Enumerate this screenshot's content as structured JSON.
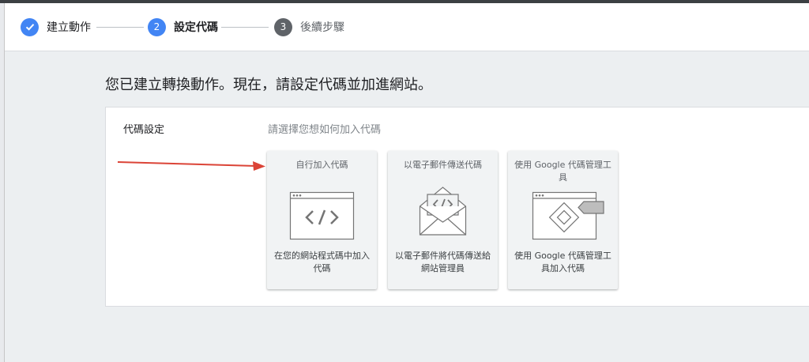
{
  "stepper": {
    "steps": [
      {
        "label": "建立動作",
        "state": "done"
      },
      {
        "label": "設定代碼",
        "number": "2",
        "state": "active"
      },
      {
        "label": "後續步驟",
        "number": "3",
        "state": "pending"
      }
    ]
  },
  "main": {
    "heading": "您已建立轉換動作。現在，請設定代碼並加進網站。",
    "panel_label": "代碼設定",
    "panel_hint": "請選擇您想如何加入代碼",
    "options": [
      {
        "title": "自行加入代碼",
        "description": "在您的網站程式碼中加入代碼",
        "icon": "code-window-icon"
      },
      {
        "title": "以電子郵件傳送代碼",
        "description": "以電子郵件將代碼傳送給網站管理員",
        "icon": "email-code-icon"
      },
      {
        "title": "使用 Google 代碼管理工具",
        "description": "使用 Google 代碼管理工具加入代碼",
        "icon": "tag-manager-icon"
      }
    ]
  },
  "colors": {
    "accent": "#4285f4",
    "pending_step": "#5f6368",
    "annotation_arrow": "#db4437"
  }
}
